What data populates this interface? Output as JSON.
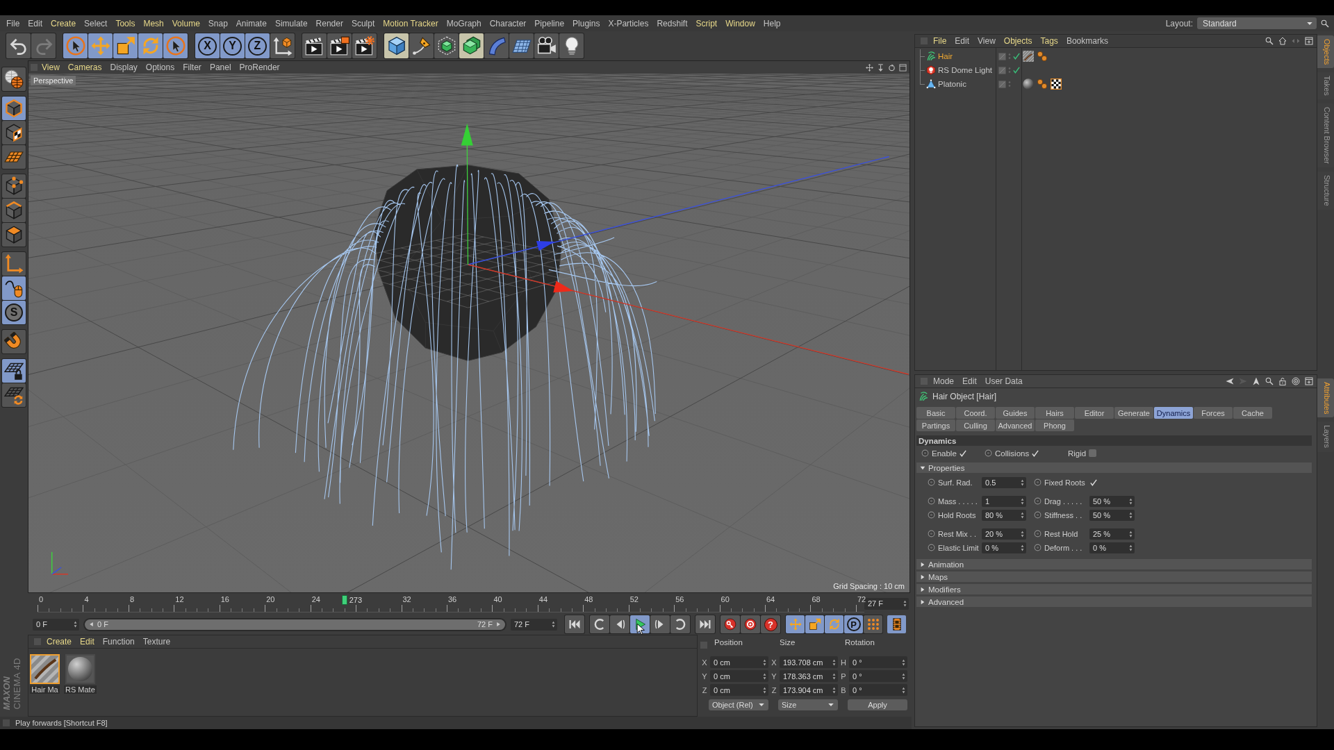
{
  "layout_selector": {
    "label": "Layout:",
    "value": "Standard"
  },
  "menu_bar": [
    {
      "label": "File",
      "highlighted": false
    },
    {
      "label": "Edit",
      "highlighted": false
    },
    {
      "label": "Create",
      "highlighted": true
    },
    {
      "label": "Select",
      "highlighted": false
    },
    {
      "label": "Tools",
      "highlighted": true
    },
    {
      "label": "Mesh",
      "highlighted": true
    },
    {
      "label": "Volume",
      "highlighted": true
    },
    {
      "label": "Snap",
      "highlighted": false
    },
    {
      "label": "Animate",
      "highlighted": false
    },
    {
      "label": "Simulate",
      "highlighted": false
    },
    {
      "label": "Render",
      "highlighted": false
    },
    {
      "label": "Sculpt",
      "highlighted": false
    },
    {
      "label": "Motion Tracker",
      "highlighted": true
    },
    {
      "label": "MoGraph",
      "highlighted": false
    },
    {
      "label": "Character",
      "highlighted": false
    },
    {
      "label": "Pipeline",
      "highlighted": false
    },
    {
      "label": "Plugins",
      "highlighted": false
    },
    {
      "label": "X-Particles",
      "highlighted": false
    },
    {
      "label": "Redshift",
      "highlighted": false
    },
    {
      "label": "Script",
      "highlighted": true
    },
    {
      "label": "Window",
      "highlighted": true
    },
    {
      "label": "Help",
      "highlighted": false
    }
  ],
  "toolbar": [
    [
      {
        "kind": "undo",
        "active": false,
        "highlighted": false,
        "disabled": false
      },
      {
        "kind": "redo",
        "active": false,
        "highlighted": false,
        "disabled": true
      }
    ],
    [
      {
        "kind": "select",
        "active": true,
        "highlighted": false,
        "disabled": false
      },
      {
        "kind": "move",
        "active": true,
        "highlighted": false,
        "disabled": false
      },
      {
        "kind": "scale",
        "active": true,
        "highlighted": false,
        "disabled": false
      },
      {
        "kind": "rotate",
        "active": true,
        "highlighted": false,
        "disabled": false
      },
      {
        "kind": "last-tool",
        "active": true,
        "highlighted": false,
        "disabled": false
      }
    ],
    [
      {
        "kind": "axis-lock",
        "label": "X",
        "active": true,
        "highlighted": false,
        "disabled": false
      },
      {
        "kind": "axis-lock",
        "label": "Y",
        "active": true,
        "highlighted": false,
        "disabled": false
      },
      {
        "kind": "axis-lock",
        "label": "Z",
        "active": true,
        "highlighted": false,
        "disabled": false
      },
      {
        "kind": "coordinate-system",
        "active": false,
        "highlighted": false,
        "disabled": false
      }
    ],
    [
      {
        "kind": "render-view",
        "active": false,
        "highlighted": false,
        "disabled": false
      },
      {
        "kind": "render-picture",
        "active": false,
        "highlighted": false,
        "disabled": false
      },
      {
        "kind": "render-settings",
        "active": false,
        "highlighted": false,
        "disabled": false
      }
    ],
    [
      {
        "kind": "cube",
        "active": false,
        "highlighted": true,
        "disabled": false
      },
      {
        "kind": "pen",
        "active": false,
        "highlighted": false,
        "disabled": false
      },
      {
        "kind": "subdivision",
        "active": false,
        "highlighted": false,
        "disabled": false
      },
      {
        "kind": "array",
        "active": false,
        "highlighted": true,
        "disabled": false
      },
      {
        "kind": "deformer",
        "active": false,
        "highlighted": false,
        "disabled": false
      },
      {
        "kind": "floor",
        "active": false,
        "highlighted": false,
        "disabled": false
      },
      {
        "kind": "camera",
        "active": false,
        "highlighted": false,
        "disabled": false
      },
      {
        "kind": "light",
        "active": false,
        "highlighted": false,
        "disabled": false
      }
    ]
  ],
  "mode_toolbar": [
    [
      {
        "kind": "viewport-solo",
        "active": false
      }
    ],
    [
      {
        "kind": "model",
        "active": true
      },
      {
        "kind": "texture",
        "active": false
      },
      {
        "kind": "workplane",
        "active": false
      }
    ],
    [
      {
        "kind": "points",
        "active": false
      },
      {
        "kind": "edges",
        "active": false
      },
      {
        "kind": "polygons",
        "active": false
      }
    ],
    [
      {
        "kind": "axis",
        "active": false
      },
      {
        "kind": "tweak",
        "active": true
      },
      {
        "kind": "solo",
        "label": "S",
        "active": true
      }
    ],
    [
      {
        "kind": "snap",
        "active": false
      }
    ],
    [
      {
        "kind": "workplane-lock",
        "active": true
      },
      {
        "kind": "workplane-rotate",
        "active": false
      }
    ]
  ],
  "viewport": {
    "menu": [
      {
        "label": "View",
        "highlighted": true
      },
      {
        "label": "Cameras",
        "highlighted": true
      },
      {
        "label": "Display",
        "highlighted": false
      },
      {
        "label": "Options",
        "highlighted": false
      },
      {
        "label": "Filter",
        "highlighted": false
      },
      {
        "label": "Panel",
        "highlighted": false
      },
      {
        "label": "ProRender",
        "highlighted": false
      }
    ],
    "camera": "Perspective",
    "grid_spacing": "Grid Spacing : 10 cm"
  },
  "timeline": {
    "ticks_before_playhead": [
      "0",
      "4",
      "8",
      "12",
      "16",
      "20",
      "24"
    ],
    "playhead": {
      "label": "273",
      "level": 0.375
    },
    "ticks_after_playhead": [
      "32",
      "36",
      "40",
      "44",
      "48",
      "52",
      "56",
      "60",
      "64",
      "68",
      "72"
    ],
    "frame_field": "27 F"
  },
  "transport": {
    "start_field": "0 F",
    "range": {
      "start": "0 F",
      "end": "72 F",
      "level": 1
    },
    "end_field": "72 F",
    "playback_buttons": [
      {
        "kind": "go-start",
        "active": false
      },
      {
        "kind": "previous-key",
        "active": false
      },
      {
        "kind": "previous-frame",
        "active": false
      },
      {
        "kind": "play",
        "active": true
      },
      {
        "kind": "next-frame",
        "active": false
      },
      {
        "kind": "next-key",
        "active": false
      },
      {
        "kind": "go-end",
        "active": false
      }
    ],
    "record_buttons": [
      {
        "kind": "record",
        "active": false
      },
      {
        "kind": "autokey",
        "active": false
      },
      {
        "kind": "keyframe-selection",
        "label": "?",
        "active": false
      }
    ],
    "key_buttons": [
      {
        "kind": "position",
        "active": true
      },
      {
        "kind": "scale",
        "active": true
      },
      {
        "kind": "rotation",
        "active": true
      },
      {
        "kind": "parameter",
        "label": "P",
        "active": true
      },
      {
        "kind": "point-level",
        "active": false
      }
    ],
    "timeline_toggle": {
      "active": true
    }
  },
  "material_manager": {
    "menu": [
      {
        "label": "Create",
        "highlighted": true
      },
      {
        "label": "Edit",
        "highlighted": true
      },
      {
        "label": "Function",
        "highlighted": false
      },
      {
        "label": "Texture",
        "highlighted": false
      }
    ],
    "materials": [
      {
        "name": "Hair Ma",
        "kind": "hair",
        "selected": true
      },
      {
        "name": "RS Mate",
        "kind": "standard",
        "selected": false
      }
    ]
  },
  "coordinates": {
    "columns": [
      "Position",
      "Size",
      "Rotation"
    ],
    "rows": [
      [
        {
          "axis": "X",
          "value": "0 cm"
        },
        {
          "axis": "X",
          "value": "193.708 cm"
        },
        {
          "axis": "H",
          "value": "0 °"
        }
      ],
      [
        {
          "axis": "Y",
          "value": "0 cm"
        },
        {
          "axis": "Y",
          "value": "178.363 cm"
        },
        {
          "axis": "P",
          "value": "0 °"
        }
      ],
      [
        {
          "axis": "Z",
          "value": "0 cm"
        },
        {
          "axis": "Z",
          "value": "173.904 cm"
        },
        {
          "axis": "B",
          "value": "0 °"
        }
      ]
    ],
    "modes": [
      "Object (Rel)",
      "Size"
    ],
    "apply": "Apply"
  },
  "status_bar": {
    "text": "Play forwards [Shortcut F8]"
  },
  "logo": {
    "brand": "MAXON",
    "product": "CINEMA 4D"
  },
  "object_manager": {
    "menu": [
      {
        "label": "File",
        "highlighted": true
      },
      {
        "label": "Edit",
        "highlighted": false
      },
      {
        "label": "View",
        "highlighted": false
      },
      {
        "label": "Objects",
        "highlighted": true
      },
      {
        "label": "Tags",
        "highlighted": true
      },
      {
        "label": "Bookmarks",
        "highlighted": false
      }
    ],
    "objects": [
      {
        "name": "Hair",
        "kind": "hair",
        "selected": true,
        "enabled": true,
        "tags": [
          {
            "kind": "hair-material"
          },
          {
            "kind": "object-tag"
          }
        ]
      },
      {
        "name": "RS Dome Light",
        "kind": "dome-light",
        "selected": false,
        "enabled": true
      },
      {
        "name": "Platonic",
        "kind": "platonic",
        "selected": false,
        "enabled": false,
        "tags": [
          {
            "kind": "material"
          },
          {
            "kind": "object-tag"
          },
          {
            "kind": "texture-tag"
          }
        ]
      }
    ]
  },
  "attribute_manager": {
    "menu": [
      "Mode",
      "Edit",
      "User Data"
    ],
    "title": "Hair Object [Hair]",
    "tab_rows": [
      [
        {
          "label": "Basic",
          "selected": false
        },
        {
          "label": "Coord.",
          "selected": false
        },
        {
          "label": "Guides",
          "selected": false
        },
        {
          "label": "Hairs",
          "selected": false
        },
        {
          "label": "Editor",
          "selected": false
        },
        {
          "label": "Generate",
          "selected": false
        },
        {
          "label": "Dynamics",
          "selected": true
        },
        {
          "label": "Forces",
          "selected": false
        },
        {
          "label": "Cache",
          "selected": false
        }
      ],
      [
        {
          "label": "Partings",
          "selected": false
        },
        {
          "label": "Culling",
          "selected": false
        },
        {
          "label": "Advanced",
          "selected": false
        },
        {
          "label": "Phong",
          "selected": false
        }
      ]
    ],
    "section": "Dynamics",
    "toggles": [
      {
        "label": "Enable",
        "checked": true,
        "animatable": true
      },
      {
        "label": "Collisions",
        "checked": true,
        "animatable": true
      },
      {
        "label": "Rigid",
        "checked": false,
        "animatable": false
      }
    ],
    "groups": [
      {
        "label": "Properties",
        "expanded": true,
        "field_blocks": [
          [
            [
              {
                "kind": "number",
                "label": "Surf. Rad.",
                "value": "0.5"
              },
              {
                "kind": "checkbox",
                "label": "Fixed Roots",
                "checked": true
              }
            ]
          ],
          [
            [
              {
                "kind": "number",
                "label": "Mass . . . . .",
                "value": "1"
              },
              {
                "kind": "number",
                "label": "Drag . . . . .",
                "value": "50 %"
              }
            ],
            [
              {
                "kind": "number",
                "label": "Hold Roots",
                "value": "80 %"
              },
              {
                "kind": "number",
                "label": "Stiffness . .",
                "value": "50 %"
              }
            ]
          ],
          [
            [
              {
                "kind": "number",
                "label": "Rest Mix . .",
                "value": "20 %"
              },
              {
                "kind": "number",
                "label": "Rest Hold",
                "value": "25 %"
              }
            ],
            [
              {
                "kind": "number",
                "label": "Elastic Limit",
                "value": "0 %"
              },
              {
                "kind": "number",
                "label": "Deform . . .",
                "value": "0 %"
              }
            ]
          ]
        ]
      },
      {
        "label": "Animation",
        "expanded": false
      },
      {
        "label": "Maps",
        "expanded": false
      },
      {
        "label": "Modifiers",
        "expanded": false
      },
      {
        "label": "Advanced",
        "expanded": false
      }
    ]
  },
  "side_tabs": {
    "upper": [
      {
        "label": "Objects",
        "selected": true
      },
      {
        "label": "Takes",
        "selected": false
      },
      {
        "label": "Content Browser",
        "selected": false
      },
      {
        "label": "Structure",
        "selected": false
      }
    ],
    "lower": [
      {
        "label": "Attributes",
        "selected": true
      },
      {
        "label": "Layers",
        "selected": false
      }
    ]
  }
}
